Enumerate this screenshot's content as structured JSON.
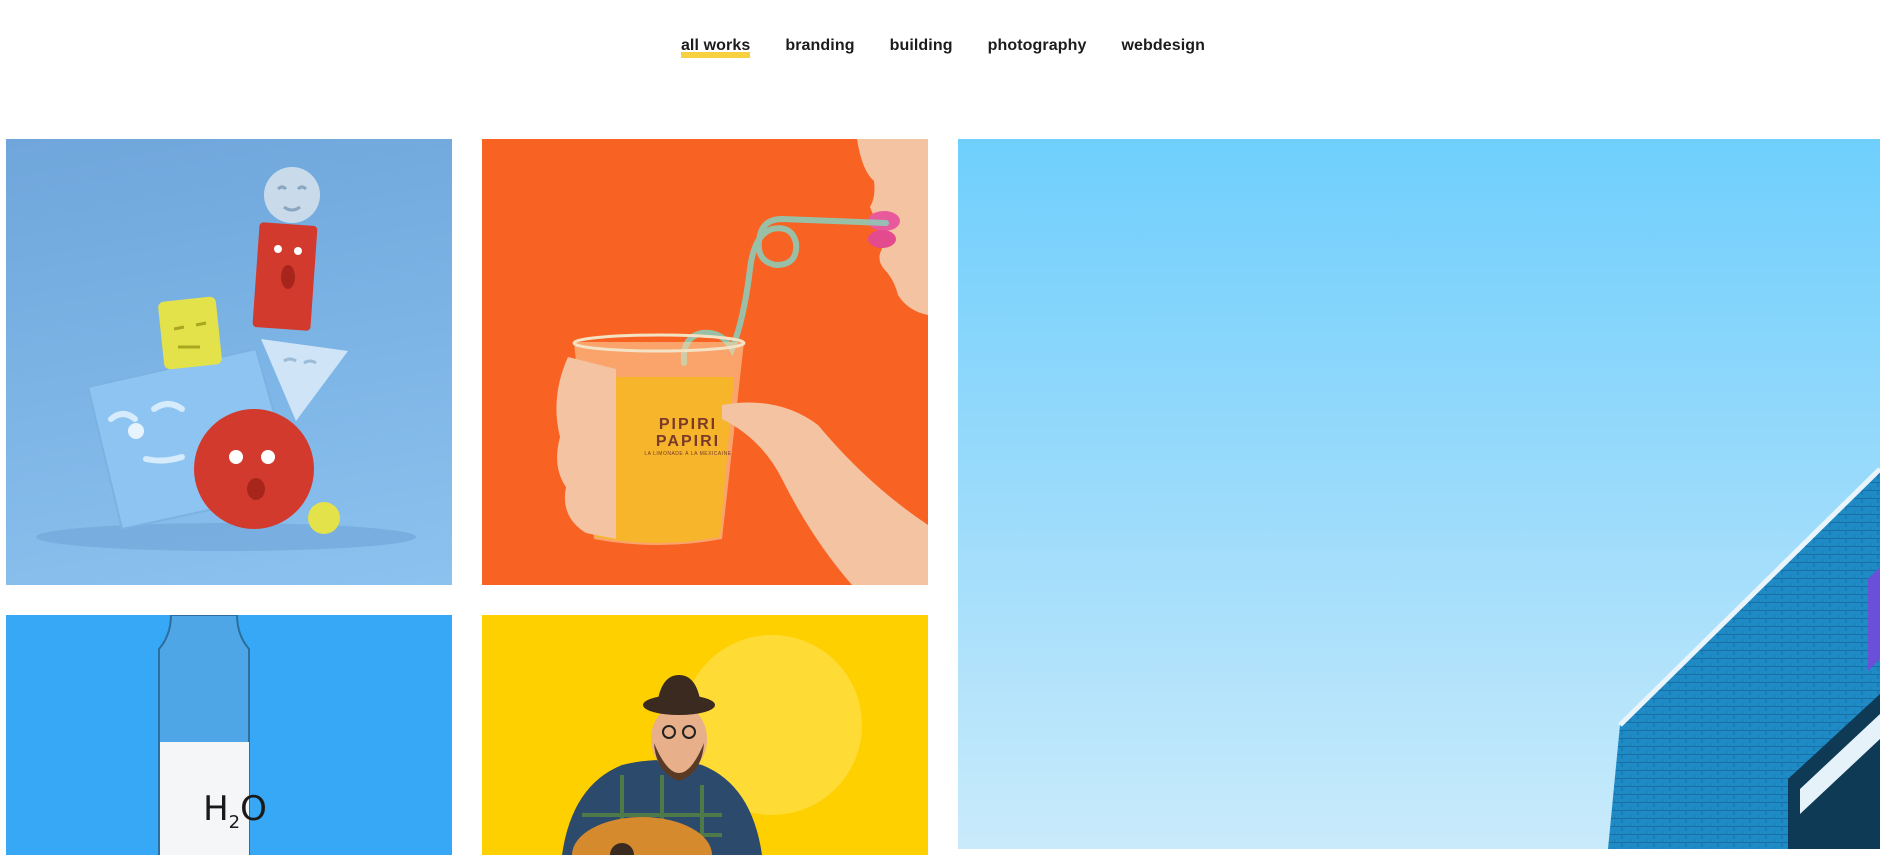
{
  "filters": [
    {
      "label": "all works",
      "active": true
    },
    {
      "label": "branding",
      "active": false
    },
    {
      "label": "building",
      "active": false
    },
    {
      "label": "photography",
      "active": false
    },
    {
      "label": "webdesign",
      "active": false
    }
  ],
  "colors": {
    "accent_underline": "#f7d13f",
    "tile1_bg": "#7fb7e8",
    "tile2_bg": "#f86324",
    "tile3_sky": "#6fcffc",
    "tile4_bg": "#36a8f5",
    "tile5_bg": "#ffd000"
  },
  "portfolio": {
    "cup_brand": "PIPIRI PAPIRI",
    "cup_subtitle": "LA LIMONADE À LA MEXICAINE",
    "bottle_label_main": "H",
    "bottle_label_sub": "2",
    "bottle_label_end": "O"
  }
}
